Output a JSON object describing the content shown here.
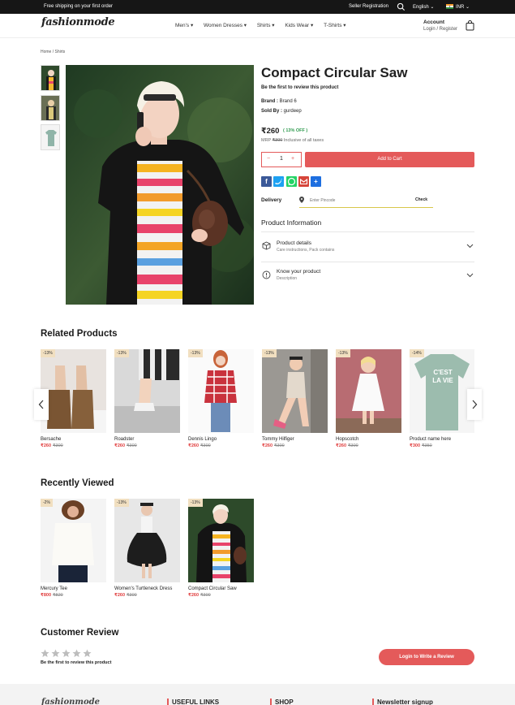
{
  "topbar": {
    "shipping": "Free shipping on your first order",
    "seller": "Seller Registration",
    "language": "English ⌄",
    "currency": "INR ⌄"
  },
  "header": {
    "logo": "fashionmode",
    "nav": [
      "Men's ▾",
      "Women Dresses ▾",
      "Shirts ▾",
      "Kids Wear ▾",
      "T-Shirts ▾"
    ],
    "account_label": "Account",
    "account_sub": "Login / Register"
  },
  "breadcrumb": "Home  /  Shirts",
  "product": {
    "title": "Compact Circular Saw",
    "review_prompt": "Be the first to review this product",
    "brand_label": "Brand :",
    "brand_value": " Brand 6",
    "sold_label": "Sold By :",
    "sold_value": " gurdeep",
    "price": "₹260",
    "discount": "( 13% OFF )",
    "mrp_label": "MRP ",
    "mrp_value": "₹300",
    "mrp_suffix": " Inclusive of all taxes",
    "qty_minus": "−",
    "qty_value": "1",
    "qty_plus": "+",
    "add_to_cart": "Add to Cart",
    "share": [
      "facebook-icon",
      "twitter-icon",
      "whatsapp-icon",
      "gmail-icon",
      "share-plus-icon"
    ],
    "delivery_label": "Delivery",
    "pincode_placeholder": "Enter Pincode",
    "check": "Check",
    "info_title": "Product Information",
    "details_title": "Product details",
    "details_sub": "Care instructions, Pack contains",
    "know_title": "Know your product",
    "know_sub": "Description"
  },
  "related": {
    "title": "Related Products",
    "items": [
      {
        "badge": "-13%",
        "name": "Bersache",
        "price": "₹260",
        "old": "₹300"
      },
      {
        "badge": "-13%",
        "name": "Roadster",
        "price": "₹260",
        "old": "₹300"
      },
      {
        "badge": "-13%",
        "name": "Dennis Lingo",
        "price": "₹260",
        "old": "₹300"
      },
      {
        "badge": "-13%",
        "name": "Tommy Hilfiger",
        "price": "₹260",
        "old": "₹300"
      },
      {
        "badge": "-13%",
        "name": "Hopscotch",
        "price": "₹260",
        "old": "₹300"
      },
      {
        "badge": "-14%",
        "name": "Product name here",
        "price": "₹300",
        "old": "₹350"
      }
    ],
    "tee_text": "C'EST LA VIE"
  },
  "recent": {
    "title": "Recently Viewed",
    "items": [
      {
        "badge": "-2%",
        "name": "Mercury Tee",
        "price": "₹800",
        "old": "₹820"
      },
      {
        "badge": "-13%",
        "name": "Women's Turtleneck Dress",
        "price": "₹260",
        "old": "₹300"
      },
      {
        "badge": "-13%",
        "name": "Compact Circular Saw",
        "price": "₹260",
        "old": "₹300"
      }
    ]
  },
  "review": {
    "title": "Customer Review",
    "prompt": "Be the first to review this product",
    "stars_filled": 0,
    "stars_total": 5,
    "button": "Login to Write a Review"
  },
  "footer": {
    "logo": "fashionmode",
    "useful": "USEFUL LINKS",
    "shop": "SHOP",
    "newsletter": "Newsletter signup"
  },
  "colors": {
    "accent": "#e45a5a",
    "topbar": "#161616",
    "discount": "#2e9a4e",
    "badge": "#f1dfc0"
  }
}
